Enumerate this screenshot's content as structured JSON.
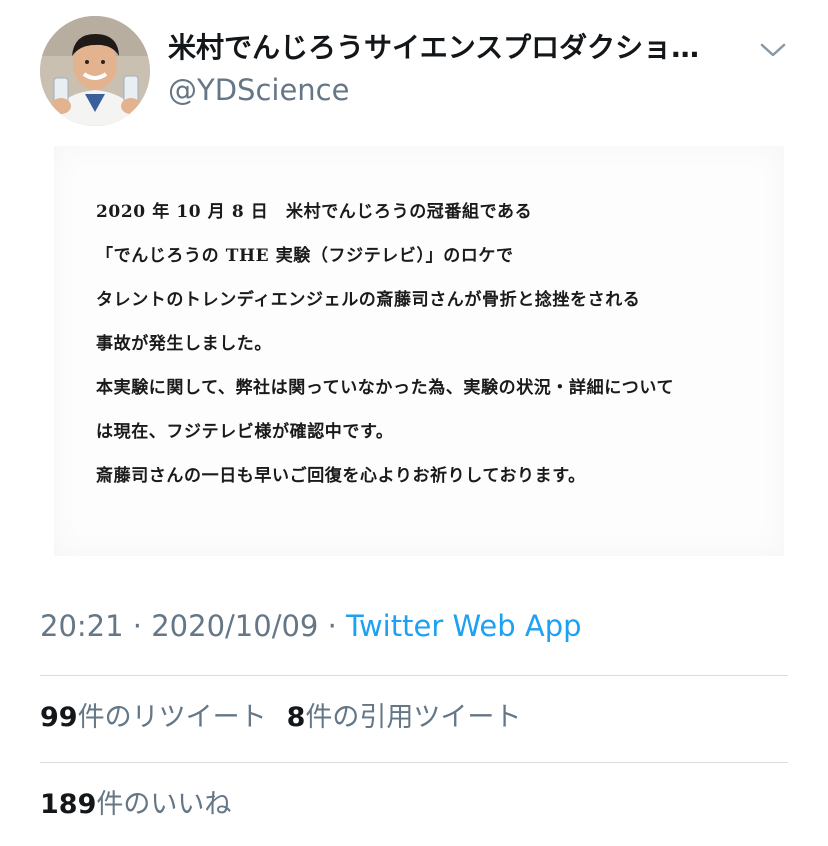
{
  "tweet": {
    "author": {
      "display_name": "米村でんじろうサイエンスプロダクショ…",
      "handle": "@YDScience",
      "avatar_icon": "avatar-photo"
    },
    "more_icon": "chevron-down-icon",
    "image_text": {
      "lines": [
        "2020 年 10 月 8 日　米村でんじろうの冠番組である",
        "「でんじろうの THE 実験（フジテレビ）」のロケで",
        "タレントのトレンディエンジェルの斎藤司さんが骨折と捻挫をされる",
        "事故が発生しました。",
        "本実験に関して、弊社は関っていなかった為、実験の状況・詳細について",
        "は現在、フジテレビ様が確認中です。",
        "斎藤司さんの一日も早いご回復を心よりお祈りしております。"
      ]
    },
    "time": "20:21",
    "separator": "·",
    "date": "2020/10/09",
    "source": "Twitter Web App",
    "stats": {
      "retweets_count": "99",
      "retweets_label": "件のリツイート",
      "quotes_count": "8",
      "quotes_label": "件の引用ツイート",
      "likes_count": "189",
      "likes_label": "件のいいね"
    },
    "colors": {
      "link": "#1da1f2",
      "secondary_text": "#657786",
      "primary_text": "#14171a",
      "divider": "#d8dde1"
    }
  }
}
